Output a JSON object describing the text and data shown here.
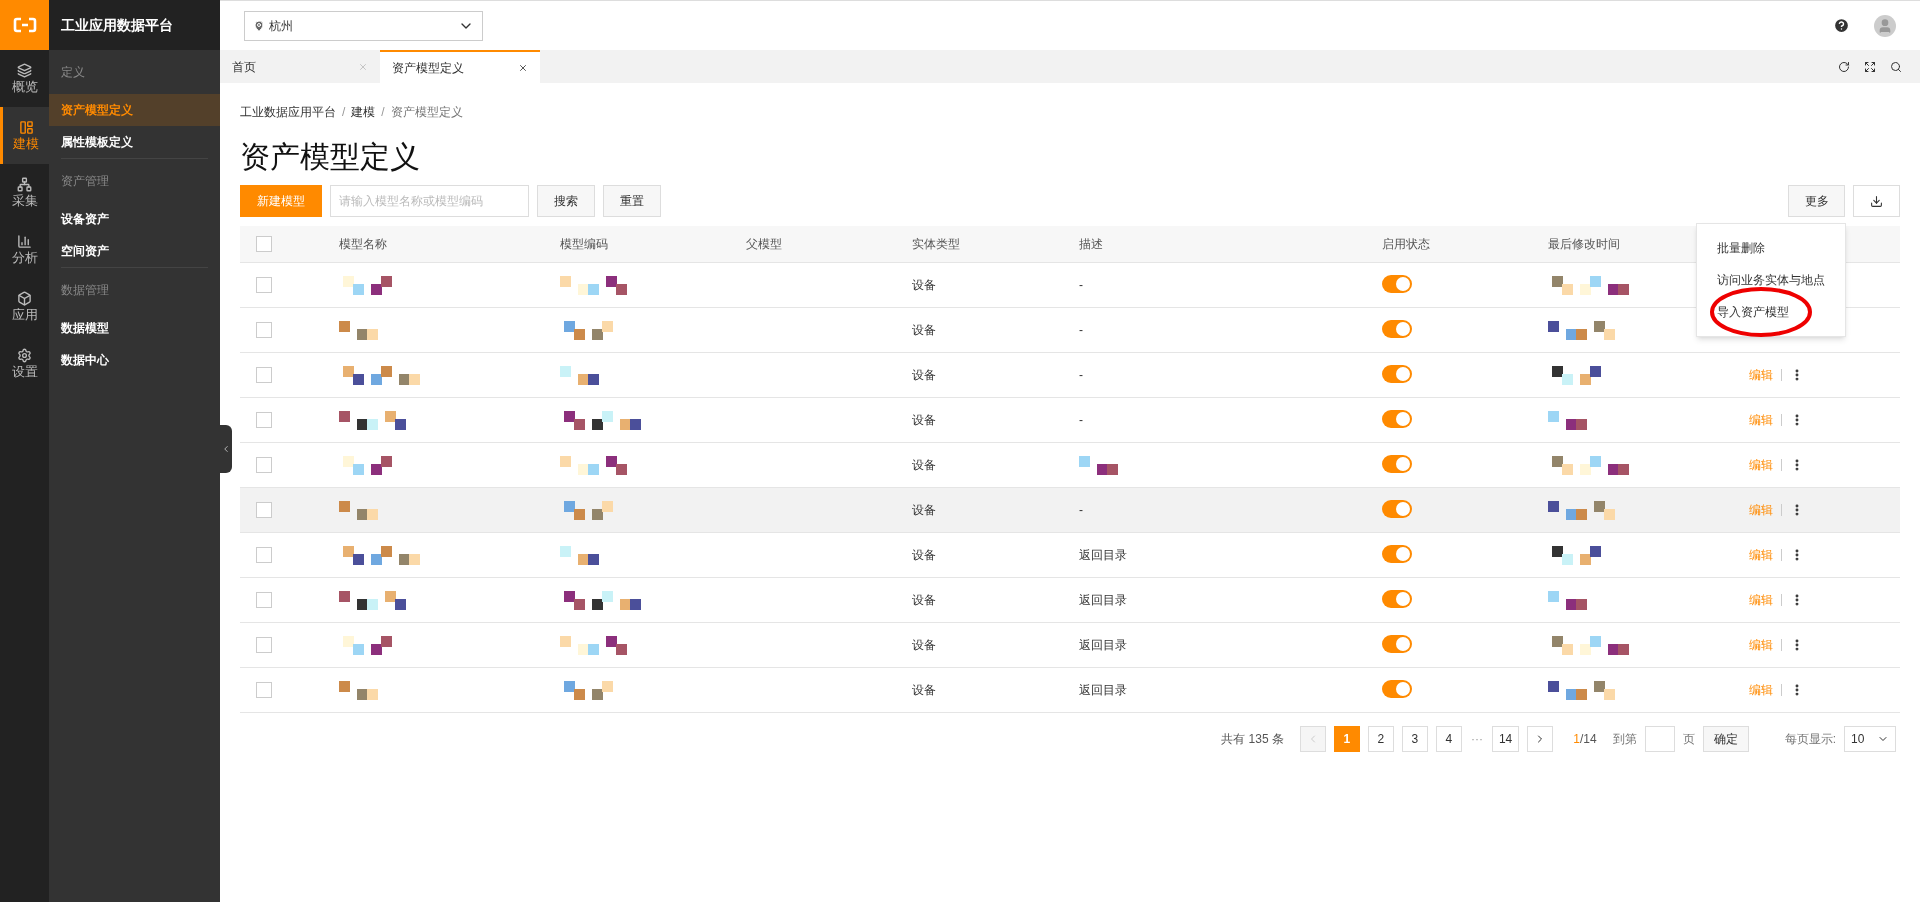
{
  "brand": {
    "title": "工业应用数据平台"
  },
  "rail": [
    {
      "label": "概览",
      "selected": false
    },
    {
      "label": "建模",
      "selected": true
    },
    {
      "label": "采集",
      "selected": false
    },
    {
      "label": "分析",
      "selected": false
    },
    {
      "label": "应用",
      "selected": false
    },
    {
      "label": "设置",
      "selected": false
    }
  ],
  "sidebar": {
    "groups": [
      {
        "title": "定义",
        "items": [
          {
            "label": "资产模型定义",
            "selected": true
          },
          {
            "label": "属性模板定义",
            "selected": false
          }
        ]
      },
      {
        "title": "资产管理",
        "items": [
          {
            "label": "设备资产",
            "selected": false
          },
          {
            "label": "空间资产",
            "selected": false
          }
        ]
      },
      {
        "title": "数据管理",
        "items": [
          {
            "label": "数据模型",
            "selected": false
          },
          {
            "label": "数据中心",
            "selected": false
          }
        ]
      }
    ]
  },
  "location_select": {
    "value": "杭州"
  },
  "tabs": [
    {
      "label": "首页",
      "selected": false
    },
    {
      "label": "资产模型定义",
      "selected": true
    }
  ],
  "breadcrumb": [
    {
      "kind": "link",
      "label": "工业数据应用平台"
    },
    {
      "kind": "separator",
      "label": "/"
    },
    {
      "kind": "link",
      "label": "建模"
    },
    {
      "kind": "separator",
      "label": "/"
    },
    {
      "kind": "current",
      "label": "资产模型定义"
    }
  ],
  "page_title": "资产模型定义",
  "toolbar": {
    "new_button": "新建模型",
    "search": {
      "placeholder": "请输入模型名称或模型编码"
    },
    "search_button": "搜索",
    "reset_button": "重置",
    "more_button": "更多"
  },
  "more_menu": {
    "open": true,
    "items": [
      {
        "label": "批量删除",
        "highlighted": false
      },
      {
        "label": "访问业务实体与地点",
        "highlighted": false
      },
      {
        "label": "导入资产模型",
        "highlighted": true
      }
    ]
  },
  "table": {
    "select_all_checked": false,
    "columns": [
      "模型名称",
      "模型编码",
      "父模型",
      "实体类型",
      "描述",
      "启用状态",
      "最后修改时间"
    ],
    "rows": [
      {
        "checked": false,
        "hovered": false,
        "entity_type": "设备",
        "description": "-",
        "enabled": true
      },
      {
        "checked": false,
        "hovered": false,
        "entity_type": "设备",
        "description": "-",
        "enabled": true
      },
      {
        "checked": false,
        "hovered": false,
        "entity_type": "设备",
        "description": "-",
        "enabled": true,
        "action": "编辑"
      },
      {
        "checked": false,
        "hovered": false,
        "entity_type": "设备",
        "description": "-",
        "enabled": true,
        "action": "编辑"
      },
      {
        "checked": false,
        "hovered": false,
        "entity_type": "设备",
        "enabled": true,
        "action": "编辑"
      },
      {
        "checked": false,
        "hovered": true,
        "entity_type": "设备",
        "description": "-",
        "enabled": true,
        "action": "编辑"
      },
      {
        "checked": false,
        "hovered": false,
        "entity_type": "设备",
        "description": "返回目录",
        "enabled": true,
        "action": "编辑"
      },
      {
        "checked": false,
        "hovered": false,
        "entity_type": "设备",
        "description": "返回目录",
        "enabled": true,
        "action": "编辑"
      },
      {
        "checked": false,
        "hovered": false,
        "entity_type": "设备",
        "description": "返回目录",
        "enabled": true,
        "action": "编辑"
      },
      {
        "checked": false,
        "hovered": false,
        "entity_type": "设备",
        "description": "返回目录",
        "enabled": true,
        "action": "编辑"
      }
    ]
  },
  "pagination": {
    "total": "共有 135 条",
    "prev_disabled": true,
    "pages": [
      {
        "label": "1",
        "selected": true
      },
      {
        "label": "2",
        "selected": false
      },
      {
        "label": "3",
        "selected": false
      },
      {
        "label": "4",
        "selected": false
      },
      {
        "label": "···",
        "kind": "ellipsis"
      },
      {
        "label": "14",
        "selected": false
      }
    ],
    "current": "1",
    "of": "/14",
    "goto_label": "到第",
    "goto_suffix": "页",
    "confirm": "确定",
    "page_size_label": "每页显示:",
    "page_size": "10"
  }
}
